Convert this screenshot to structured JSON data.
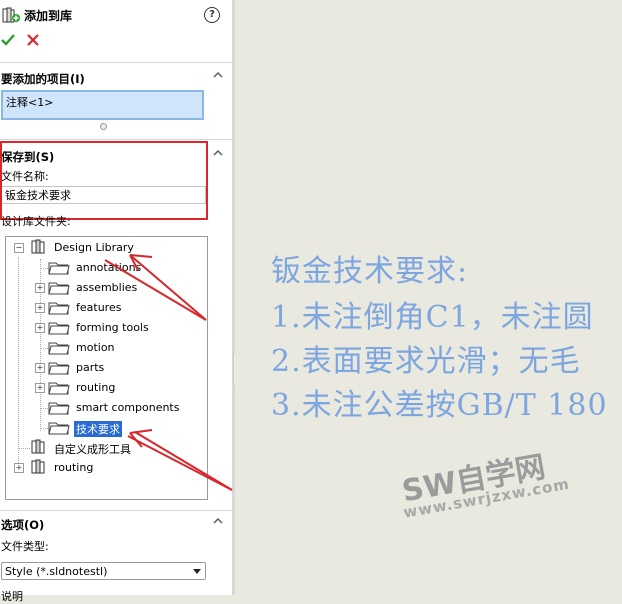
{
  "panel": {
    "title": "添加到库",
    "help_glyph": "?",
    "icons": {
      "title": "library-add-icon",
      "ok": "checkmark-icon",
      "cancel": "close-icon"
    },
    "colors": {
      "ok": "#2ca02c",
      "cancel": "#d9262b",
      "highlight_frame": "#d9262b",
      "selected_item": "#2a6bd3",
      "arrows": "#d9262b"
    }
  },
  "items_section": {
    "heading": "要添加的项目(I)",
    "value": "注释<1>"
  },
  "save_section": {
    "heading": "保存到(S)",
    "file_name_label": "文件名称:",
    "file_name_value": "钣金技术要求",
    "folder_label": "设计库文件夹:"
  },
  "tree": {
    "root": {
      "label": "Design Library"
    },
    "children": [
      {
        "label": "annotations"
      },
      {
        "label": "assemblies"
      },
      {
        "label": "features"
      },
      {
        "label": "forming tools"
      },
      {
        "label": "motion"
      },
      {
        "label": "parts"
      },
      {
        "label": "routing"
      },
      {
        "label": "smart components"
      },
      {
        "label": "技术要求"
      }
    ],
    "selected": "技术要求",
    "other_roots": [
      {
        "label": "自定义成形工具"
      },
      {
        "label": "routing"
      }
    ]
  },
  "options_section": {
    "heading": "选项(O)",
    "file_type_label": "文件类型:",
    "file_type_value": "Style (*.sldnotestl)",
    "desc_label": "说明"
  },
  "canvas": {
    "note_lines": [
      "钣金技术要求:",
      "1.未注倒角C1，未注圆",
      "2.表面要求光滑；无毛",
      "3.未注公差按GB/T 180"
    ],
    "note_color": "#7da6e0",
    "watermark_title": "SW自学网",
    "watermark_url": "www.swrjzxw.com"
  }
}
